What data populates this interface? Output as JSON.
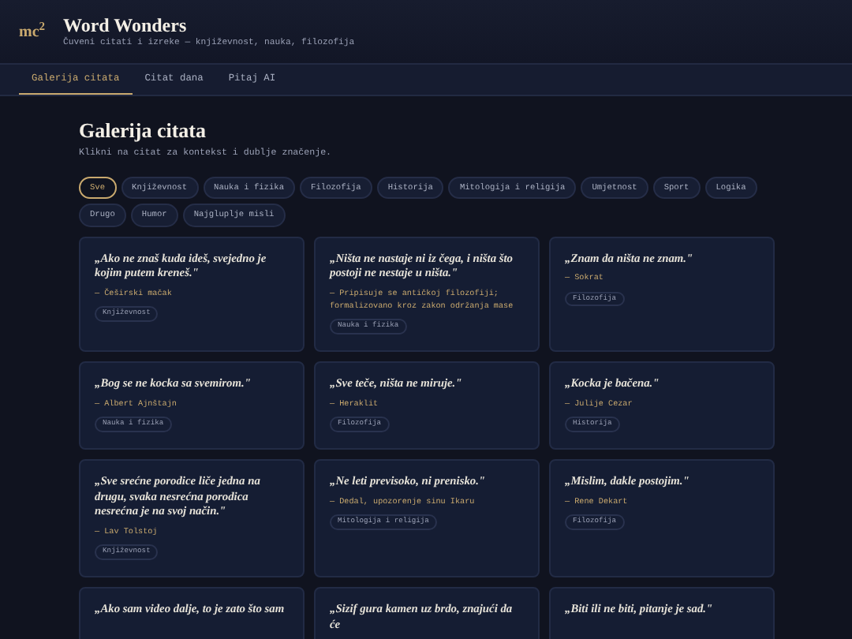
{
  "header": {
    "logo": "mc$^{2}$",
    "title": "Word Wonders",
    "subtitle": "Čuveni citati i izreke — književnost, nauka, filozofija"
  },
  "tabs": [
    {
      "label": "Galerija citata",
      "selected": true
    },
    {
      "label": "Citat dana",
      "selected": false
    },
    {
      "label": "Pitaj AI",
      "selected": false
    }
  ],
  "page": {
    "title": "Galerija citata",
    "subtitle": "Klikni na citat za kontekst i dublje značenje."
  },
  "filters": [
    {
      "label": "Sve",
      "selected": true
    },
    {
      "label": "Književnost",
      "selected": false
    },
    {
      "label": "Nauka i fizika",
      "selected": false
    },
    {
      "label": "Filozofija",
      "selected": false
    },
    {
      "label": "Historija",
      "selected": false
    },
    {
      "label": "Mitologija i religija",
      "selected": false
    },
    {
      "label": "Umjetnost",
      "selected": false
    },
    {
      "label": "Sport",
      "selected": false
    },
    {
      "label": "Logika",
      "selected": false
    },
    {
      "label": "Drugo",
      "selected": false
    },
    {
      "label": "Humor",
      "selected": false
    },
    {
      "label": "Najgluplje misli",
      "selected": false
    }
  ],
  "quotes": [
    {
      "text": "„Ako ne znaš kuda ideš, svejedno je kojim putem kreneš.\"",
      "author": "— Češirski mačak",
      "tag": "Književnost"
    },
    {
      "text": "„Ništa ne nastaje ni iz čega, i ništa što postoji ne nestaje u ništa.\"",
      "author": "— Pripisuje se antičkoj filozofiji; formalizovano kroz zakon održanja mase",
      "tag": "Nauka i fizika"
    },
    {
      "text": "„Znam da ništa ne znam.\"",
      "author": "— Sokrat",
      "tag": "Filozofija"
    },
    {
      "text": "„Bog se ne kocka sa svemirom.\"",
      "author": "— Albert Ajnštajn",
      "tag": "Nauka i fizika"
    },
    {
      "text": "„Sve teče, ništa ne miruje.\"",
      "author": "— Heraklit",
      "tag": "Filozofija"
    },
    {
      "text": "„Kocka je bačena.\"",
      "author": "— Julije Cezar",
      "tag": "Historija"
    },
    {
      "text": "„Sve srećne porodice liče jedna na drugu, svaka nesrećna porodica nesrećna je na svoj način.\"",
      "author": "— Lav Tolstoj",
      "tag": "Književnost"
    },
    {
      "text": "„Ne leti previsoko, ni prenisko.\"",
      "author": "— Dedal, upozorenje sinu Ikaru",
      "tag": "Mitologija i religija"
    },
    {
      "text": "„Mislim, dakle postojim.\"",
      "author": "— Rene Dekart",
      "tag": "Filozofija"
    },
    {
      "text": "„Ako sam video dalje, to je zato što sam"
    },
    {
      "text": "„Sizif gura kamen uz brdo, znajući da će"
    },
    {
      "text": "„Biti ili ne biti, pitanje je sad.\""
    }
  ]
}
